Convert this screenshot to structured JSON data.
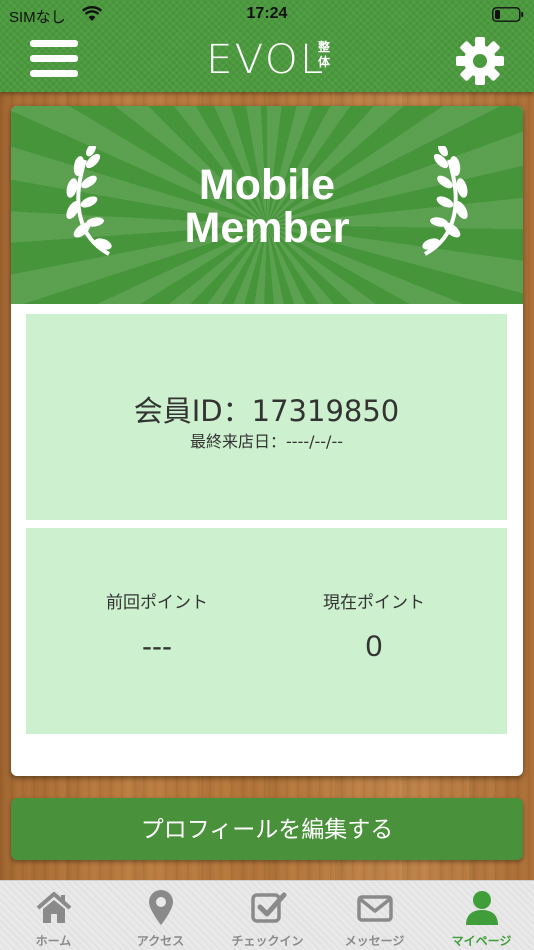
{
  "status_bar": {
    "carrier": "SIMなし",
    "time": "17:24"
  },
  "header": {
    "logo_text": "EVOL",
    "logo_sub": "整体",
    "menu_icon": "menu-icon",
    "settings_icon": "gear-icon"
  },
  "card": {
    "banner_title_line1": "Mobile",
    "banner_title_line2": "Member",
    "member_id_label": "会員ID：",
    "member_id": "17319850",
    "last_visit_label": "最終来店日：",
    "last_visit": "----/--/--",
    "previous_points_label": "前回ポイント",
    "previous_points": "---",
    "current_points_label": "現在ポイント",
    "current_points": "0"
  },
  "edit_profile_label": "プロフィールを編集する",
  "tabs": [
    {
      "label": "ホーム",
      "icon": "home-icon"
    },
    {
      "label": "アクセス",
      "icon": "map-pin-icon"
    },
    {
      "label": "チェックイン",
      "icon": "checkbox-icon"
    },
    {
      "label": "メッセージ",
      "icon": "envelope-icon"
    },
    {
      "label": "マイページ",
      "icon": "user-icon",
      "active": true
    }
  ],
  "colors": {
    "brand_green": "#4b9a3d",
    "panel_green": "#cdf0cf",
    "tab_active": "#3f9d3a",
    "tab_inactive": "#8a8a8a"
  }
}
